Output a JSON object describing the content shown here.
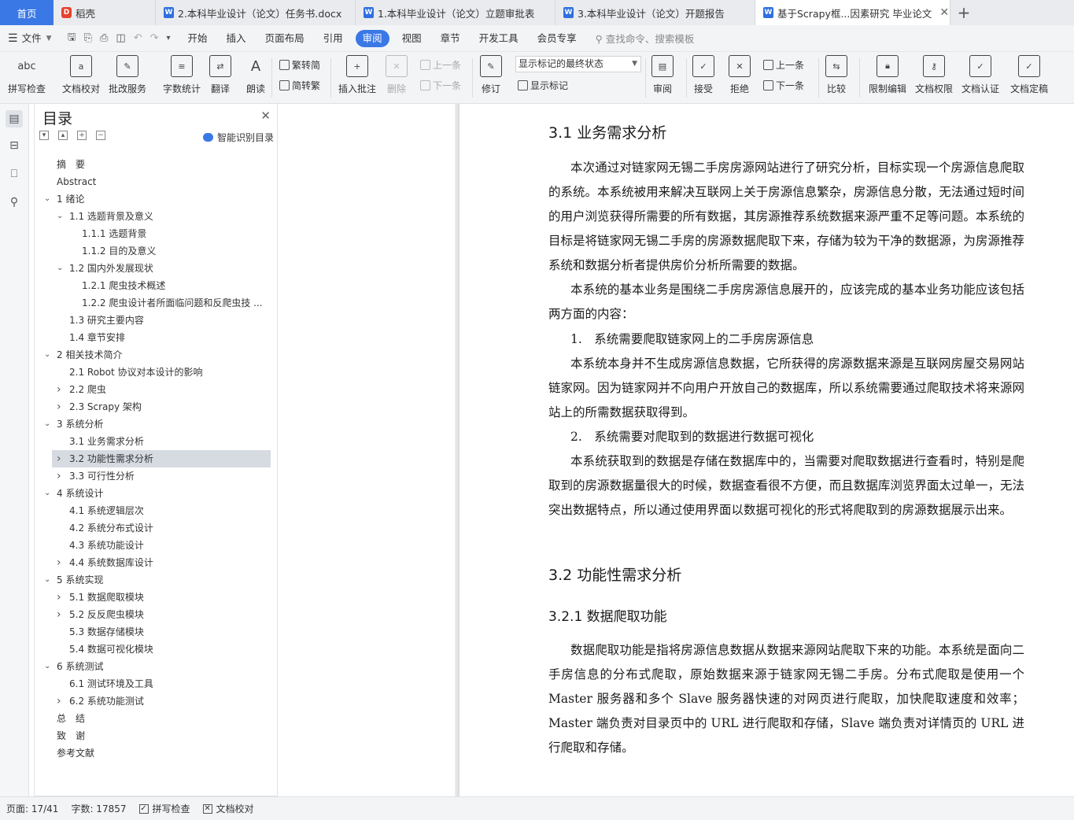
{
  "tabs": [
    {
      "label": "首页",
      "type": "home"
    },
    {
      "label": "稻壳",
      "type": "docer"
    },
    {
      "label": "2.本科毕业设计（论文）任务书.docx",
      "type": "word"
    },
    {
      "label": "1.本科毕业设计（论文）立题审批表",
      "type": "word"
    },
    {
      "label": "3.本科毕业设计（论文）开题报告",
      "type": "word"
    },
    {
      "label": "基于Scrapy框...因素研究 毕业论文",
      "type": "word",
      "active": true
    }
  ],
  "menu": {
    "file": "文件",
    "items": [
      "开始",
      "插入",
      "页面布局",
      "引用",
      "审阅",
      "视图",
      "章节",
      "开发工具",
      "会员专享"
    ],
    "active": "审阅",
    "search": "查找命令、搜索模板"
  },
  "ribbon": {
    "spell": "拼写检查",
    "proof": "文档校对",
    "annot_service": "批改服务",
    "wordcount": "字数统计",
    "translate": "翻译",
    "read": "朗读",
    "t2s": "繁转简",
    "s2t": "简转繁",
    "insert_comment": "插入批注",
    "delete": "删除",
    "prev_comment": "上一条",
    "next_comment": "下一条",
    "track": "修订",
    "markup_state": "显示标记的最终状态",
    "show_markup": "显示标记",
    "review": "审阅",
    "accept": "接受",
    "reject": "拒绝",
    "prev_change": "上一条",
    "next_change": "下一条",
    "compare": "比较",
    "restrict": "限制编辑",
    "permission": "文档权限",
    "certify": "文档认证",
    "finalize": "文档定稿"
  },
  "toc": {
    "title": "目录",
    "smart": "智能识别目录",
    "items": [
      {
        "text": "摘　要",
        "level": 0,
        "arrow": ""
      },
      {
        "text": "Abstract",
        "level": 0,
        "arrow": ""
      },
      {
        "text": "1  绪论",
        "level": 0,
        "arrow": "v"
      },
      {
        "text": "1.1  选题背景及意义",
        "level": 1,
        "arrow": "v"
      },
      {
        "text": "1.1.1  选题背景",
        "level": 2,
        "arrow": ""
      },
      {
        "text": "1.1.2  目的及意义",
        "level": 2,
        "arrow": ""
      },
      {
        "text": "1.2  国内外发展现状",
        "level": 1,
        "arrow": "v"
      },
      {
        "text": "1.2.1  爬虫技术概述",
        "level": 2,
        "arrow": ""
      },
      {
        "text": "1.2.2  爬虫设计者所面临问题和反爬虫技 ...",
        "level": 2,
        "arrow": ""
      },
      {
        "text": "1.3  研究主要内容",
        "level": 1,
        "arrow": ""
      },
      {
        "text": "1.4  章节安排",
        "level": 1,
        "arrow": ""
      },
      {
        "text": "2  相关技术简介",
        "level": 0,
        "arrow": "v"
      },
      {
        "text": "2.1 Robot 协议对本设计的影响",
        "level": 1,
        "arrow": ""
      },
      {
        "text": "2.2  爬虫",
        "level": 1,
        "arrow": ">"
      },
      {
        "text": "2.3 Scrapy 架构",
        "level": 1,
        "arrow": ">"
      },
      {
        "text": "3  系统分析",
        "level": 0,
        "arrow": "v"
      },
      {
        "text": "3.1  业务需求分析",
        "level": 1,
        "arrow": ""
      },
      {
        "text": "3.2  功能性需求分析",
        "level": 1,
        "arrow": ">",
        "selected": true
      },
      {
        "text": "3.3  可行性分析",
        "level": 1,
        "arrow": ">"
      },
      {
        "text": "4  系统设计",
        "level": 0,
        "arrow": "v"
      },
      {
        "text": "4.1  系统逻辑层次",
        "level": 1,
        "arrow": ""
      },
      {
        "text": "4.2  系统分布式设计",
        "level": 1,
        "arrow": ""
      },
      {
        "text": "4.3  系统功能设计",
        "level": 1,
        "arrow": ""
      },
      {
        "text": "4.4  系统数据库设计",
        "level": 1,
        "arrow": ">"
      },
      {
        "text": "5  系统实现",
        "level": 0,
        "arrow": "v"
      },
      {
        "text": "5.1  数据爬取模块",
        "level": 1,
        "arrow": ">"
      },
      {
        "text": "5.2  反反爬虫模块",
        "level": 1,
        "arrow": ">"
      },
      {
        "text": "5.3  数据存储模块",
        "level": 1,
        "arrow": ""
      },
      {
        "text": "5.4  数据可视化模块",
        "level": 1,
        "arrow": ""
      },
      {
        "text": "6  系统测试",
        "level": 0,
        "arrow": "v"
      },
      {
        "text": "6.1  测试环境及工具",
        "level": 1,
        "arrow": ""
      },
      {
        "text": "6.2  系统功能测试",
        "level": 1,
        "arrow": ">"
      },
      {
        "text": "总　结",
        "level": 0,
        "arrow": ""
      },
      {
        "text": "致　谢",
        "level": 0,
        "arrow": ""
      },
      {
        "text": "参考文献",
        "level": 0,
        "arrow": ""
      }
    ]
  },
  "document": {
    "h_3_1": "3.1  业务需求分析",
    "p1": "本次通过对链家网无锡二手房房源网站进行了研究分析，目标实现一个房源信息爬取的系统。本系统被用来解决互联网上关于房源信息繁杂，房源信息分散，无法通过短时间的用户浏览获得所需要的所有数据，其房源推荐系统数据来源严重不足等问题。本系统的目标是将链家网无锡二手房的房源数据爬取下来，存储为较为干净的数据源，为房源推荐系统和数据分析者提供房价分析所需要的数据。",
    "p2": "本系统的基本业务是围绕二手房房源信息展开的，应该完成的基本业务功能应该包括两方面的内容：",
    "li1": "1.　系统需要爬取链家网上的二手房房源信息",
    "p3": "本系统本身并不生成房源信息数据，它所获得的房源数据来源是互联网房屋交易网站链家网。因为链家网并不向用户开放自己的数据库，所以系统需要通过爬取技术将来源网站上的所需数据获取得到。",
    "li2": "2.　系统需要对爬取到的数据进行数据可视化",
    "p4": "本系统获取到的数据是存储在数据库中的，当需要对爬取数据进行查看时，特别是爬取到的房源数据量很大的时候，数据查看很不方便，而且数据库浏览界面太过单一，无法突出数据特点，所以通过使用界面以数据可视化的形式将爬取到的房源数据展示出来。",
    "h_3_2": "3.2  功能性需求分析",
    "h_3_2_1": "3.2.1  数据爬取功能",
    "p5": "数据爬取功能是指将房源信息数据从数据来源网站爬取下来的功能。本系统是面向二手房信息的分布式爬取，原始数据来源于链家网无锡二手房。分布式爬取是使用一个 Master 服务器和多个 Slave 服务器快速的对网页进行爬取，加快爬取速度和效率；Master 端负责对目录页中的 URL 进行爬取和存储，Slave 端负责对详情页的 URL 进行爬取和存储。"
  },
  "status": {
    "page": "页面: 17/41",
    "words": "字数: 17857",
    "spell": "拼写检查",
    "proof": "文档校对"
  }
}
